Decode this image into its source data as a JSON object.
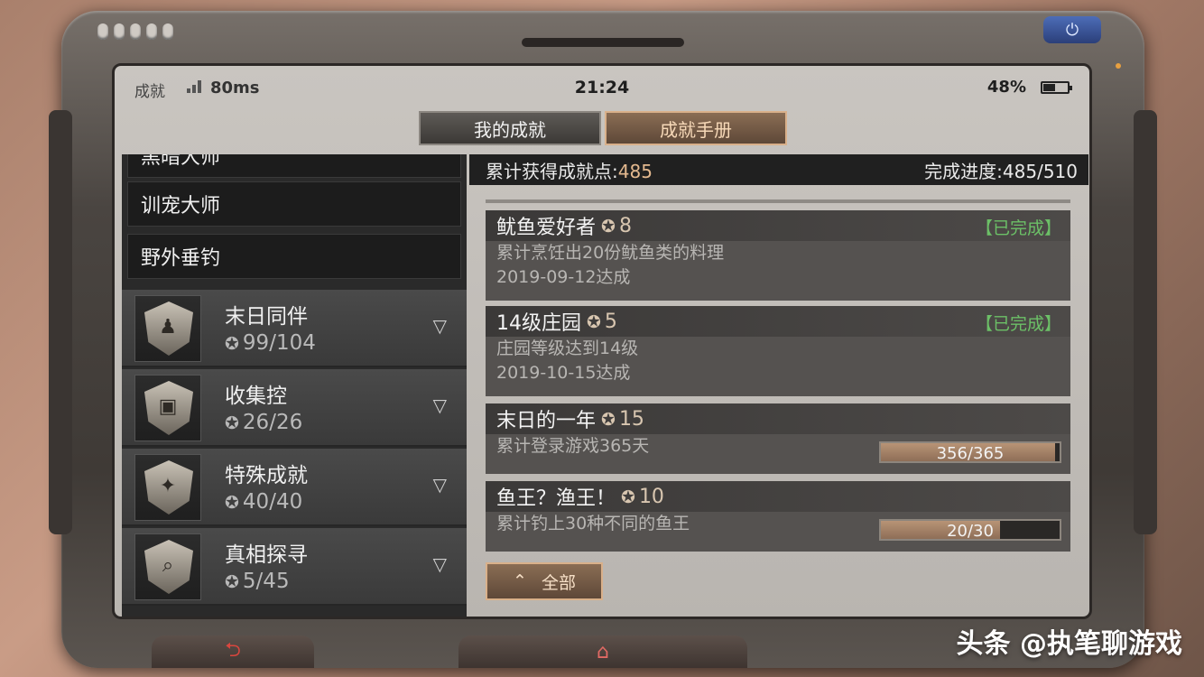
{
  "status_bar": {
    "app": "成就",
    "ping": "80ms",
    "time": "21:24",
    "battery": "48%"
  },
  "tabs": [
    {
      "label": "我的成就",
      "active": false
    },
    {
      "label": "成就手册",
      "active": true
    }
  ],
  "left_list": {
    "text_items": [
      "黑暗大师",
      "训宠大师",
      "野外垂钓"
    ],
    "categories": [
      {
        "name": "末日同伴",
        "progress": "99/104",
        "icon": "companions-badge-icon"
      },
      {
        "name": "收集控",
        "progress": "26/26",
        "icon": "chest-badge-icon"
      },
      {
        "name": "特殊成就",
        "progress": "40/40",
        "icon": "special-badge-icon"
      },
      {
        "name": "真相探寻",
        "progress": "5/45",
        "icon": "magnifier-badge-icon"
      }
    ]
  },
  "summary": {
    "points_label": "累计获得成就点:",
    "points": "485",
    "progress_label": "完成进度:",
    "progress": "485/510"
  },
  "achievements": [
    {
      "title": "鱿鱼爱好者",
      "points": "8",
      "status": "【已完成】",
      "desc": "累计烹饪出20份鱿鱼类的料理",
      "date": "2019-09-12达成"
    },
    {
      "title": "14级庄园",
      "points": "5",
      "status": "【已完成】",
      "desc": "庄园等级达到14级",
      "date": "2019-10-15达成"
    },
    {
      "title": "末日的一年",
      "points": "15",
      "desc": "累计登录游戏365天",
      "progress_text": "356/365",
      "progress_fraction": 0.975
    },
    {
      "title": "鱼王？渔王！",
      "points": "10",
      "desc": "累计钓上30种不同的鱼王",
      "progress_text": "20/30",
      "progress_fraction": 0.667
    }
  ],
  "all_button": "全部",
  "watermark": "头条 @执笔聊游戏",
  "colors": {
    "accent_gold": "#e4b98f",
    "complete_green": "#6cc067"
  }
}
